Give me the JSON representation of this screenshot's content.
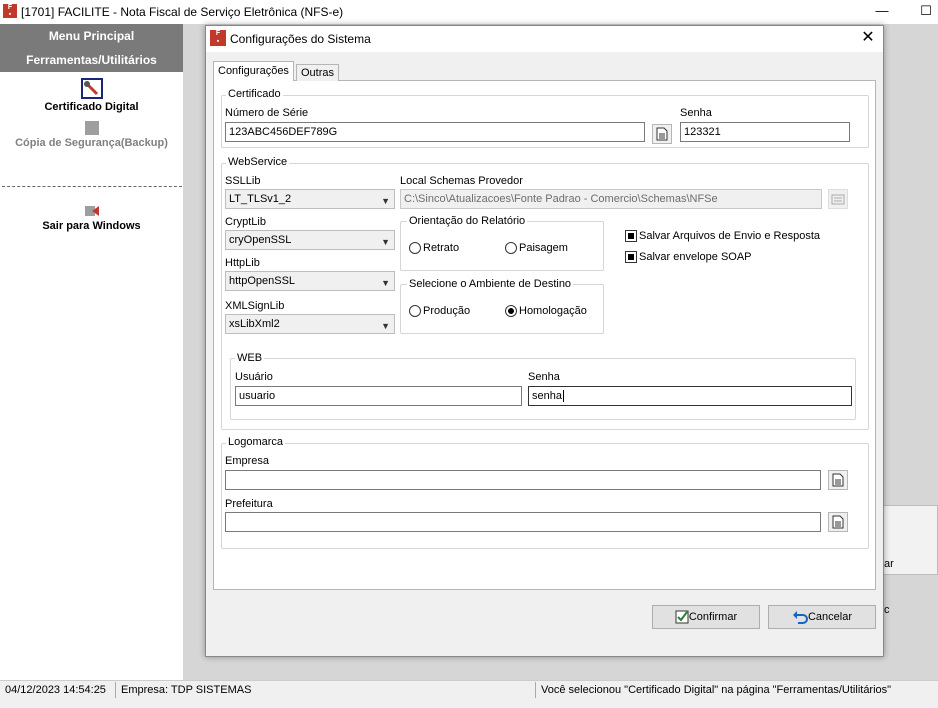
{
  "window": {
    "title": "[1701] FACILITE - Nota Fiscal de Serviço Eletrônica (NFS-e)",
    "minimize": "—",
    "maximize": "☐"
  },
  "menu": {
    "header_line1": "Menu Principal",
    "header_line2": "Ferramentas/Utilitários",
    "items": [
      {
        "label": "Certificado Digital",
        "icon": "tools-icon"
      },
      {
        "label": "Cópia de Segurança(Backup)",
        "icon": "backup-icon"
      },
      {
        "label": "Sair para Windows",
        "icon": "exit-icon"
      }
    ]
  },
  "status": {
    "datetime": "04/12/2023 14:54:25",
    "company": "Empresa: TDP SISTEMAS",
    "message": "Você selecionou \"Certificado Digital\" na página \"Ferramentas/Utilitários\""
  },
  "dialog": {
    "title": "Configurações do Sistema",
    "tabs": [
      {
        "label": "Configurações",
        "active": true
      },
      {
        "label": "Outras",
        "active": false
      }
    ],
    "certificado": {
      "legend": "Certificado",
      "serial_label": "Número de Série",
      "serial_value": "123ABC456DEF789G",
      "senha_label": "Senha",
      "senha_value": "123321"
    },
    "webservice": {
      "legend": "WebService",
      "ssllib_label": "SSLLib",
      "ssllib_value": "LT_TLSv1_2",
      "cryptlib_label": "CryptLib",
      "cryptlib_value": "cryOpenSSL",
      "httplib_label": "HttpLib",
      "httplib_value": "httpOpenSSL",
      "xmlsignlib_label": "XMLSignLib",
      "xmlsignlib_value": "xsLibXml2",
      "schemas_label": "Local Schemas Provedor",
      "schemas_value": "C:\\Sinco\\Atualizacoes\\Fonte Padrao - Comercio\\Schemas\\NFSe",
      "orientacao_legend": "Orientação do Relatório",
      "orientacao_options": [
        {
          "label": "Retrato",
          "selected": false
        },
        {
          "label": "Paisagem",
          "selected": false
        }
      ],
      "ambiente_legend": "Selecione o Ambiente de Destino",
      "ambiente_options": [
        {
          "label": "Produção",
          "selected": false
        },
        {
          "label": "Homologação",
          "selected": true
        }
      ],
      "salvar_arquivos_label": "Salvar Arquivos de Envio e Resposta",
      "salvar_arquivos_checked": true,
      "salvar_envelope_label": "Salvar envelope SOAP",
      "salvar_envelope_checked": true,
      "web": {
        "legend": "WEB",
        "usuario_label": "Usuário",
        "usuario_value": "usuario",
        "senha_label": "Senha",
        "senha_value": "senha"
      }
    },
    "logomarca": {
      "legend": "Logomarca",
      "empresa_label": "Empresa",
      "empresa_value": "",
      "prefeitura_label": "Prefeitura",
      "prefeitura_value": ""
    },
    "buttons": {
      "confirmar": "Confirmar",
      "cancelar": "Cancelar"
    }
  },
  "background_fragments": [
    "ar",
    "c"
  ]
}
